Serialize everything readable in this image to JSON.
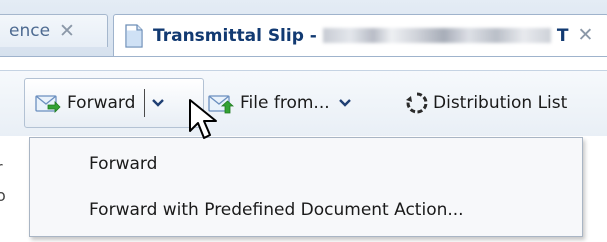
{
  "tabs": {
    "prev": {
      "label": "ence",
      "close_glyph": "✕"
    },
    "active": {
      "label": "Transmittal Slip - ",
      "suffix": "T",
      "close_glyph": "✕",
      "icon": "document-icon"
    }
  },
  "toolbar": {
    "forward": {
      "label": "Forward",
      "icon": "forward-mail-icon"
    },
    "file_from": {
      "label": "File from...",
      "icon": "file-mail-icon"
    },
    "distribution_list": {
      "label": "Distribution List",
      "icon": "refresh-circle-icon"
    }
  },
  "dropdown_menu": {
    "items": [
      {
        "label": "Forward"
      },
      {
        "label": "Forward with Predefined Document Action..."
      }
    ]
  },
  "left_gutter": {
    "char1": "r",
    "char2": "o"
  },
  "colors": {
    "tab_active_text": "#123a72",
    "tab_inactive_text": "#4d6a91",
    "toolbar_border": "#b3c2d4",
    "menu_background": "#f7f8fa",
    "accent_green": "#2fa02f"
  }
}
